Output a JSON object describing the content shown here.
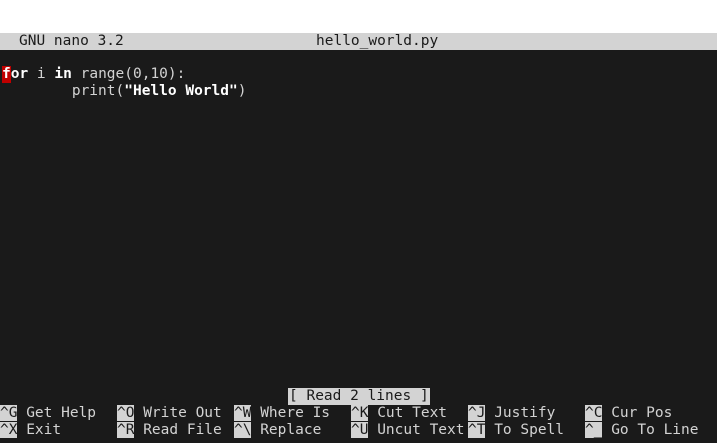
{
  "titlebar": {
    "version": "GNU nano 3.2",
    "filename": "hello_world.py"
  },
  "editor": {
    "line1": {
      "cursor_char": "f",
      "kw1_rest": "or",
      "t1": " i ",
      "kw2": "in",
      "t2": " range(0,10):"
    },
    "line2": {
      "indent": "        ",
      "t1": "print(",
      "str": "\"Hello World\"",
      "t2": ")"
    }
  },
  "status": {
    "message": "[ Read 2 lines ]"
  },
  "shortcuts": {
    "row1": [
      {
        "key": "^G",
        "label": "Get Help"
      },
      {
        "key": "^O",
        "label": "Write Out"
      },
      {
        "key": "^W",
        "label": "Where Is"
      },
      {
        "key": "^K",
        "label": "Cut Text"
      },
      {
        "key": "^J",
        "label": "Justify"
      },
      {
        "key": "^C",
        "label": "Cur Pos"
      }
    ],
    "row2": [
      {
        "key": "^X",
        "label": "Exit"
      },
      {
        "key": "^R",
        "label": "Read File"
      },
      {
        "key": "^\\",
        "label": "Replace"
      },
      {
        "key": "^U",
        "label": "Uncut Text"
      },
      {
        "key": "^T",
        "label": "To Spell"
      },
      {
        "key": "^_",
        "label": "Go To Line"
      }
    ]
  },
  "colors": {
    "terminal_bg": "#1a1a1a",
    "terminal_fg": "#d3d3d3",
    "inverse_bg": "#d3d3d3",
    "cursor_bg": "#c00000"
  }
}
